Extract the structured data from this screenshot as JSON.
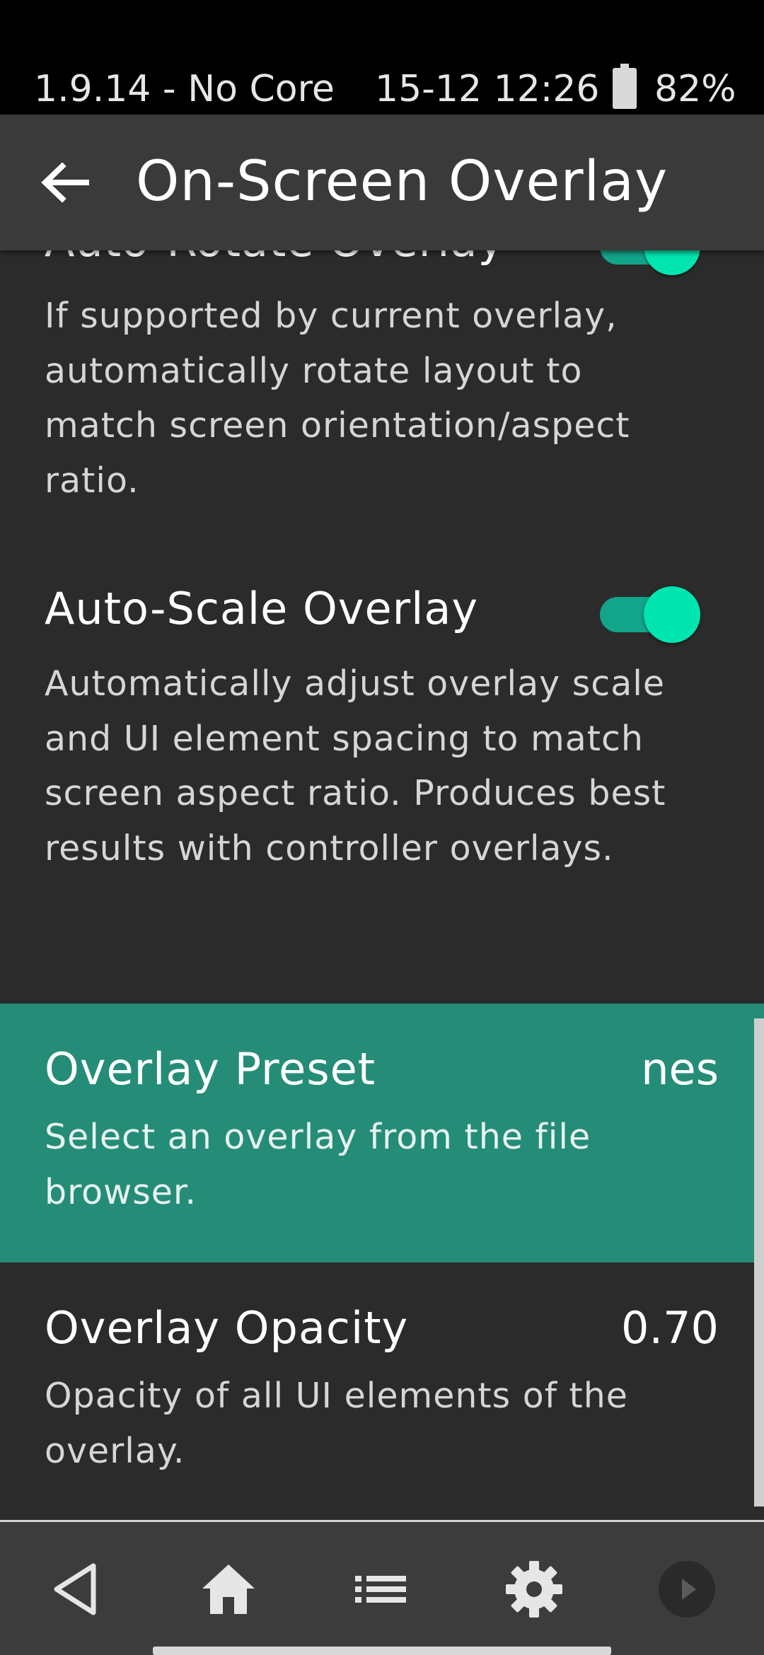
{
  "status_bar": {
    "app_version_core": "1.9.14 - No Core",
    "datetime": "15-12 12:26",
    "battery_percent": "82%",
    "battery_level": 0.82
  },
  "app_bar": {
    "title": "On-Screen Overlay",
    "back_icon": "arrow-back-icon"
  },
  "settings": {
    "auto_rotate": {
      "title": "Auto-Rotate Overlay",
      "summary": "If supported by current overlay, automatically rotate layout to match screen orientation/aspect ratio.",
      "enabled": true
    },
    "auto_scale": {
      "title": "Auto-Scale Overlay",
      "summary": "Automatically adjust overlay scale and UI element spacing to match screen aspect ratio. Produces best results with controller overlays.",
      "enabled": true
    },
    "overlay_preset": {
      "title": "Overlay Preset",
      "value": "nes",
      "summary": "Select an overlay from the file browser."
    },
    "overlay_opacity": {
      "title": "Overlay Opacity",
      "value": "0.70",
      "summary": "Opacity of all UI elements of the overlay."
    }
  },
  "bottom_nav": {
    "items": [
      {
        "icon": "back-triangle-icon"
      },
      {
        "icon": "home-icon"
      },
      {
        "icon": "list-icon"
      },
      {
        "icon": "gear-icon"
      },
      {
        "icon": "play-circle-icon"
      }
    ]
  },
  "colors": {
    "background": "#2b2b2b",
    "app_bar": "#3a3a3a",
    "highlight_row": "#258d77",
    "toggle_track": "#12a58a",
    "toggle_thumb": "#00e5b0",
    "bottom_nav": "#3c3c3c"
  }
}
